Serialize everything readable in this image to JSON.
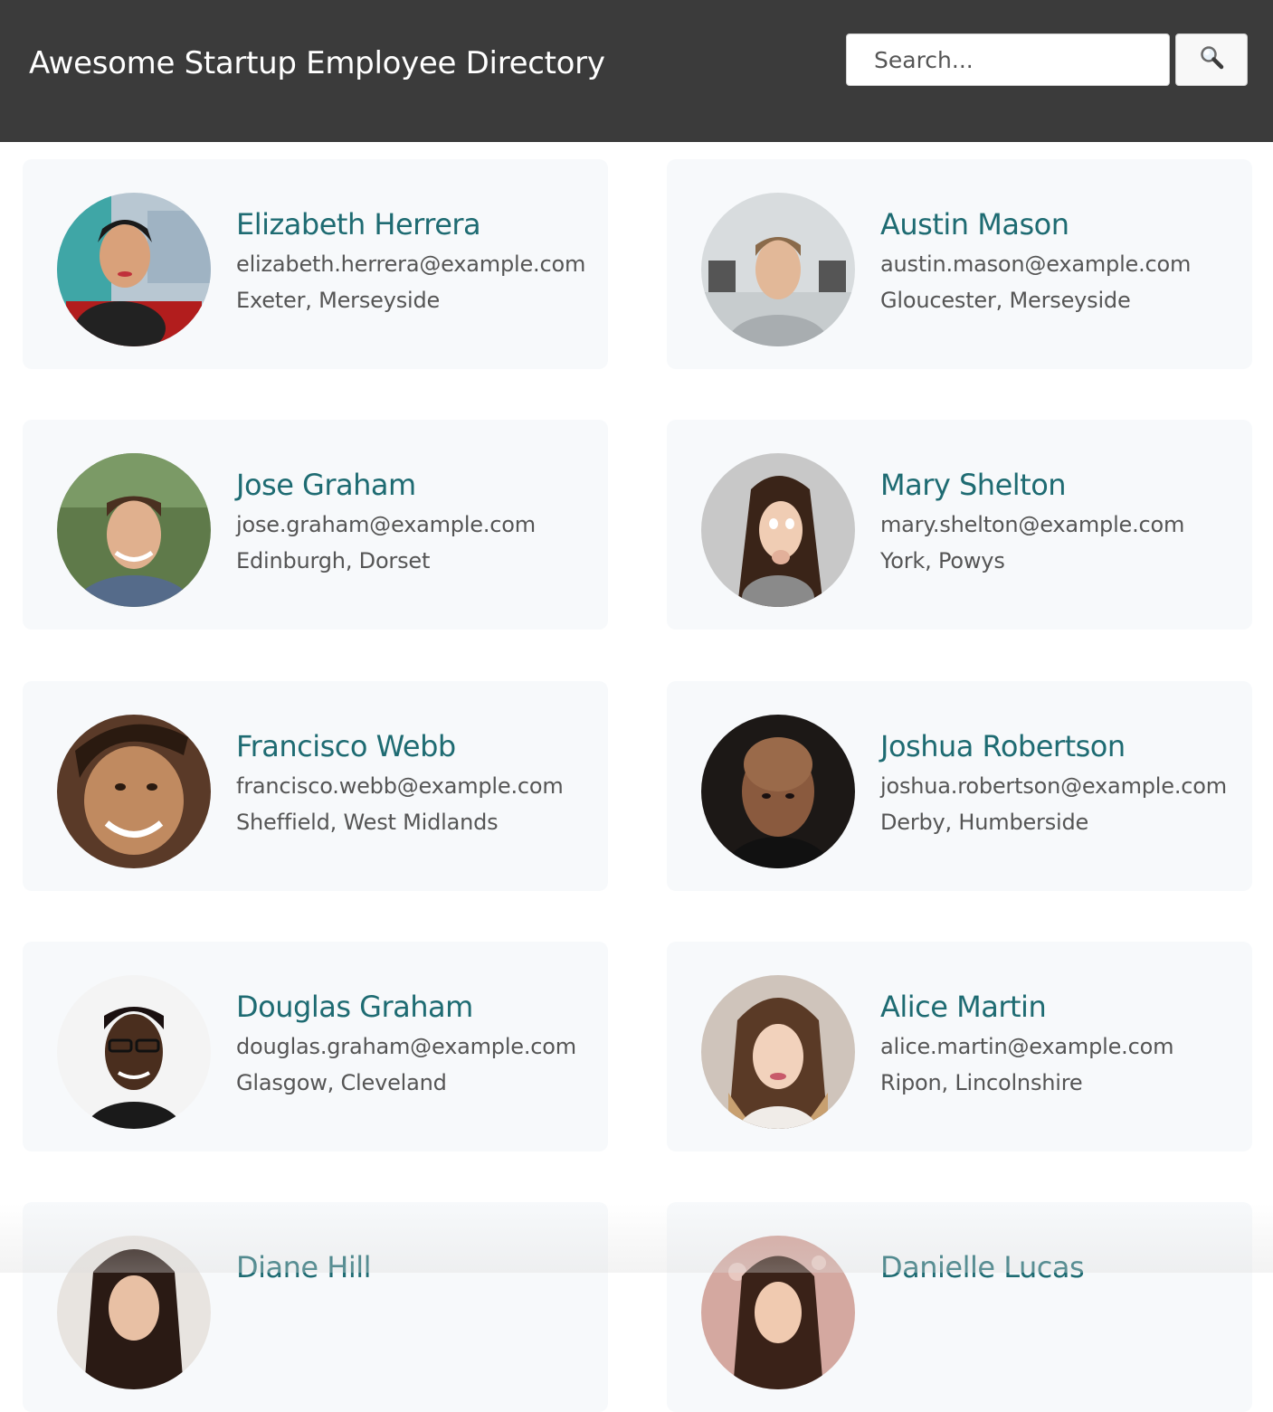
{
  "header": {
    "title": "Awesome Startup Employee Directory",
    "search_placeholder": "Search...",
    "search_icon": "magnifier-icon",
    "background": "#3b3b3b"
  },
  "accent_color": "#1e6b72",
  "employees": [
    {
      "name": "Elizabeth Herrera",
      "email": "elizabeth.herrera@example.com",
      "location": "Exeter, Merseyside",
      "photo": "woman-photo"
    },
    {
      "name": "Austin Mason",
      "email": "austin.mason@example.com",
      "location": "Gloucester, Merseyside",
      "photo": "man-photo"
    },
    {
      "name": "Jose Graham",
      "email": "jose.graham@example.com",
      "location": "Edinburgh, Dorset",
      "photo": "man-photo"
    },
    {
      "name": "Mary Shelton",
      "email": "mary.shelton@example.com",
      "location": "York, Powys",
      "photo": "woman-photo"
    },
    {
      "name": "Francisco Webb",
      "email": "francisco.webb@example.com",
      "location": "Sheffield, West Midlands",
      "photo": "man-photo"
    },
    {
      "name": "Joshua Robertson",
      "email": "joshua.robertson@example.com",
      "location": "Derby, Humberside",
      "photo": "man-photo"
    },
    {
      "name": "Douglas Graham",
      "email": "douglas.graham@example.com",
      "location": "Glasgow, Cleveland",
      "photo": "man-photo"
    },
    {
      "name": "Alice Martin",
      "email": "alice.martin@example.com",
      "location": "Ripon, Lincolnshire",
      "photo": "woman-photo"
    },
    {
      "name": "Diane Hill",
      "email": "",
      "location": "",
      "photo": "woman-photo"
    },
    {
      "name": "Danielle Lucas",
      "email": "",
      "location": "",
      "photo": "woman-photo"
    }
  ]
}
